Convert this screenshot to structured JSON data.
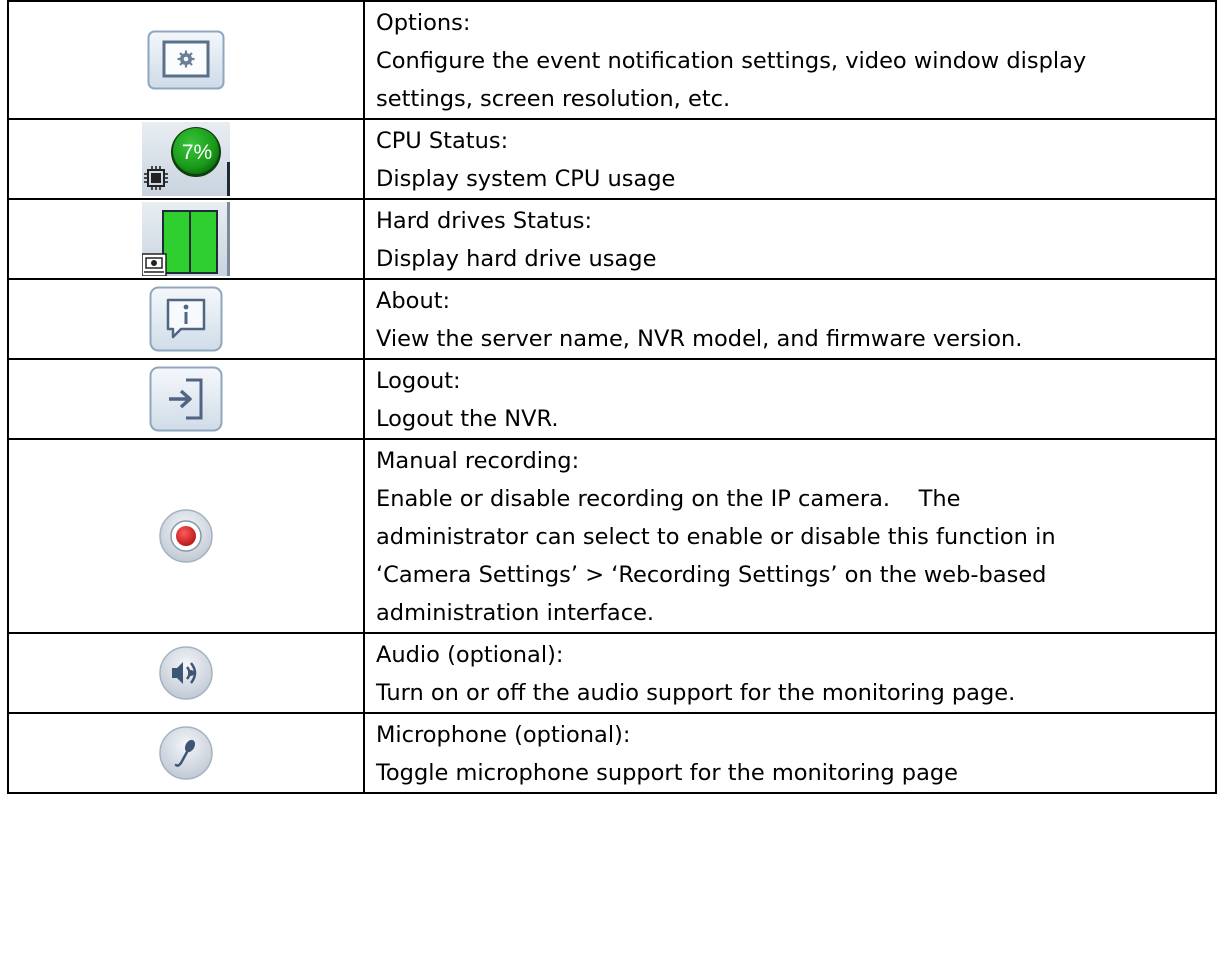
{
  "rows": [
    {
      "icon": "options-gear-icon",
      "title": "Options:",
      "lines": [
        "Configure the event notification settings, video window display",
        "settings, screen resolution, etc."
      ]
    },
    {
      "icon": "cpu-status-icon",
      "title": "CPU Status:",
      "lines": [
        "Display system CPU usage"
      ],
      "badge": "7%"
    },
    {
      "icon": "hard-drive-status-icon",
      "title": "Hard drives Status:",
      "lines": [
        "Display hard drive usage"
      ]
    },
    {
      "icon": "about-info-icon",
      "title": "About:",
      "lines": [
        "View the server name, NVR model, and firmware version."
      ]
    },
    {
      "icon": "logout-icon",
      "title": "Logout:",
      "lines": [
        "Logout the NVR."
      ]
    },
    {
      "icon": "record-icon",
      "title": "Manual recording:",
      "lines": [
        "Enable or disable recording on the IP camera.    The",
        "administrator can select to enable or disable this function in",
        "‘Camera Settings’ > ‘Recording Settings’ on the web-based",
        "administration interface."
      ]
    },
    {
      "icon": "speaker-audio-icon",
      "title": "Audio (optional):",
      "lines": [
        "Turn on or off the audio support for the monitoring page."
      ]
    },
    {
      "icon": "microphone-icon",
      "title": "Microphone (optional):",
      "lines": [
        "Toggle microphone support for the monitoring page"
      ]
    }
  ],
  "colors": {
    "cpu_green": "#1a9c1a",
    "drive_green": "#2fcf2f",
    "record_red": "#d21e1e",
    "button_blue_border": "#8fa6bf"
  }
}
